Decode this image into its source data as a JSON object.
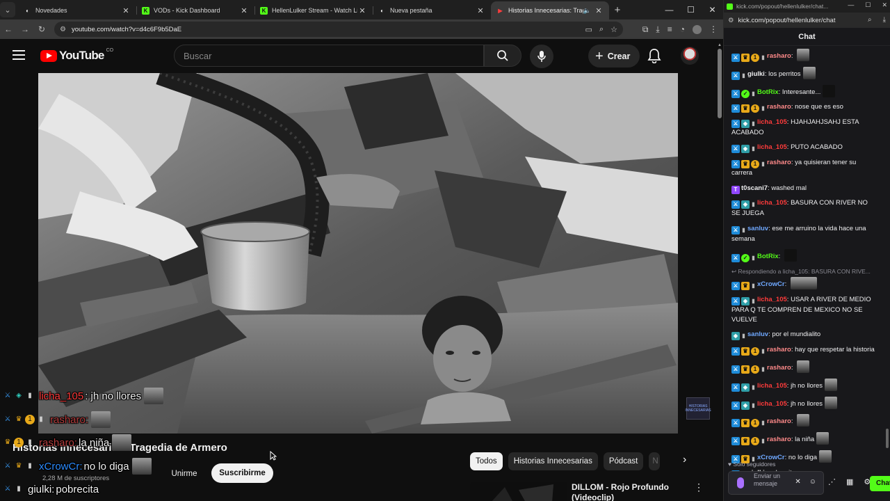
{
  "tabs": [
    {
      "title": "Novedades",
      "fav_color": "#ffffff",
      "fav_glyph": "◐",
      "active": false
    },
    {
      "title": "VODs - Kick Dashboard",
      "fav_color": "#53fc18",
      "fav_glyph": "K",
      "active": false
    },
    {
      "title": "HellenLulker Stream - Watch Li",
      "fav_color": "#53fc18",
      "fav_glyph": "K",
      "active": false
    },
    {
      "title": "Nueva pestaña",
      "fav_color": "#ffffff",
      "fav_glyph": "◐",
      "active": false
    },
    {
      "title": "Historias Innecesarias: Trag",
      "fav_color": "#ff3d3d",
      "fav_glyph": "▶",
      "active": true
    }
  ],
  "browser": {
    "url": "youtube.com/watch?v=d4c6F9b5DaE"
  },
  "youtube": {
    "logo_text": "YouTube",
    "country": "CO",
    "search_placeholder": "Buscar",
    "create_label": "Crear",
    "video_title": "Historias Innecesarias: Tragedia de Armero",
    "subs": "2,28 M de suscriptores",
    "join_label": "Unirme",
    "subscribe_label": "Suscribirme",
    "chips": [
      "Todos",
      "Historias Innecesarias",
      "Pódcast",
      "N"
    ],
    "rec_title": "DILLOM - Rojo Profundo (Videoclip)",
    "watermark": "HISTORIAS INNECESARIAS"
  },
  "overlay_chat": [
    {
      "badges": [
        "mod",
        "sub"
      ],
      "user": "licha_105",
      "user_color": "#ff3b3b",
      "msg": ": jh no llores",
      "emote": true
    },
    {
      "badges": [
        "mod",
        "vip",
        "cnt"
      ],
      "user": "rasharo:",
      "user_color": "#b43c3c",
      "msg": "",
      "emote": true
    },
    {
      "badges": [
        "vip",
        "cnt"
      ],
      "user": "rasharo:",
      "user_color": "#b43c3c",
      "msg": " la niña",
      "emote": true
    },
    {
      "badges": [
        "mod",
        "vip"
      ],
      "user": "xCrowCr:",
      "user_color": "#2c8cff",
      "msg": " no lo diga",
      "emote": true
    },
    {
      "badges": [
        "mod"
      ],
      "user": "giulki:",
      "user_color": "#f1f1f1",
      "msg": " pobrecita",
      "emote": false
    }
  ],
  "chat_window": {
    "url_short": "kick.com/popout/hellenlulker/chat...",
    "url": "kick.com/popout/hellenlulker/chat",
    "heading": "Chat",
    "footer_label": "Solo seguidores",
    "input_placeholder": "Enviar un mensaje",
    "send_label": "Chat",
    "messages": [
      {
        "badges": [
          "mod",
          "vip",
          "cnt"
        ],
        "user": "rasharo",
        "color": "#ff8a8a",
        "text": "",
        "emote": "normal"
      },
      {
        "badges": [
          "mod"
        ],
        "user": "giulki",
        "color": "#efeff1",
        "text": "los perritos",
        "emote": "normal"
      },
      {
        "badges": [
          "mod",
          "verified"
        ],
        "user": "BotRix",
        "color": "#53fc18",
        "text": "Interesante...",
        "emote": "dark"
      },
      {
        "badges": [
          "mod",
          "vip",
          "cnt"
        ],
        "user": "rasharo",
        "color": "#ff8a8a",
        "text": "nose que es eso",
        "emote": ""
      },
      {
        "badges": [
          "mod",
          "sub"
        ],
        "user": "licha_105",
        "color": "#ff3b3b",
        "text": "HJAHJAHJSAHJ ESTA ACABADO",
        "emote": ""
      },
      {
        "badges": [
          "mod",
          "sub"
        ],
        "user": "licha_105",
        "color": "#ff3b3b",
        "text": "PUTO ACABADO",
        "emote": ""
      },
      {
        "badges": [
          "mod",
          "vip",
          "cnt"
        ],
        "user": "rasharo",
        "color": "#ff8a8a",
        "text": "ya quisieran tener su carrera",
        "emote": ""
      },
      {
        "badges": [
          "tw"
        ],
        "user": "t0scani7",
        "color": "#efeff1",
        "text": "washed mal",
        "emote": ""
      },
      {
        "badges": [
          "mod",
          "sub"
        ],
        "user": "licha_105",
        "color": "#ff3b3b",
        "text": "BASURA CON RIVER NO SE JUEGA",
        "emote": ""
      },
      {
        "badges": [
          "mod"
        ],
        "user": "sanluv",
        "color": "#6fa8ff",
        "text": "ese me arruino la vida hace una semana",
        "emote": ""
      },
      {
        "badges": [
          "mod",
          "verified"
        ],
        "user": "BotRix",
        "color": "#53fc18",
        "text": "",
        "emote": "dark"
      },
      {
        "reply": "Respondiendo a licha_105: BASURA CON RIVE...",
        "badges": [
          "mod",
          "vip"
        ],
        "user": "xCrowCr",
        "color": "#6fa8ff",
        "text": "",
        "emote": "wide"
      },
      {
        "badges": [
          "mod",
          "sub"
        ],
        "user": "licha_105",
        "color": "#ff3b3b",
        "text": "USAR A RIVER DE MEDIO PARA Q TE COMPREN DE MEXICO NO SE VUELVE",
        "emote": ""
      },
      {
        "badges": [
          "sub"
        ],
        "user": "sanluv",
        "color": "#6fa8ff",
        "text": "por el mundialito",
        "emote": ""
      },
      {
        "badges": [
          "mod",
          "vip",
          "cnt"
        ],
        "user": "rasharo",
        "color": "#ff8a8a",
        "text": "hay que respetar la historia",
        "emote": ""
      },
      {
        "badges": [
          "mod",
          "vip",
          "cnt"
        ],
        "user": "rasharo",
        "color": "#ff8a8a",
        "text": "",
        "emote": "normal"
      },
      {
        "badges": [
          "mod",
          "sub"
        ],
        "user": "licha_105",
        "color": "#ff3b3b",
        "text": "jh no llores",
        "emote": "normal"
      },
      {
        "badges": [
          "mod",
          "sub"
        ],
        "user": "licha_105",
        "color": "#ff3b3b",
        "text": "jh no llores",
        "emote": "normal"
      },
      {
        "badges": [
          "mod",
          "vip",
          "cnt"
        ],
        "user": "rasharo",
        "color": "#ff8a8a",
        "text": "",
        "emote": "normal"
      },
      {
        "badges": [
          "mod",
          "vip",
          "cnt"
        ],
        "user": "rasharo",
        "color": "#ff8a8a",
        "text": "la niña",
        "emote": "normal"
      },
      {
        "badges": [
          "mod",
          "vip"
        ],
        "user": "xCrowCr",
        "color": "#6fa8ff",
        "text": "no lo diga",
        "emote": "normal"
      },
      {
        "badges": [
          "mod"
        ],
        "user": "giulki",
        "color": "#efeff1",
        "text": "pobrecita",
        "emote": ""
      }
    ]
  }
}
